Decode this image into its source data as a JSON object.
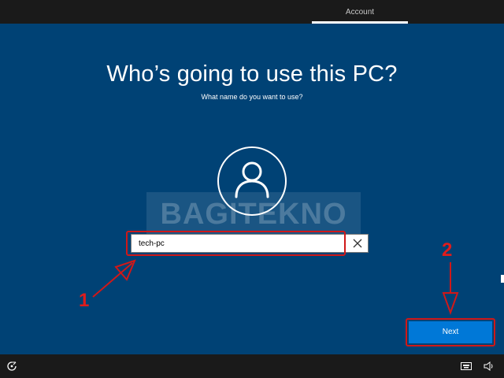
{
  "topbar": {
    "tab_account": "Account"
  },
  "page": {
    "headline": "Who’s going to use this PC?",
    "subtitle": "What name do you want to use?"
  },
  "watermark": "BAGITEKNO",
  "name_field": {
    "value": "tech-pc"
  },
  "annotations": {
    "step1": "1",
    "step2": "2"
  },
  "next_button": {
    "label": "Next"
  },
  "icons": {
    "avatar": "user-icon",
    "clear": "close-icon",
    "ease_of_access": "ease-of-access-icon",
    "keyboard": "keyboard-icon",
    "volume": "volume-icon"
  },
  "colors": {
    "background": "#004275",
    "accent": "#0078d7",
    "annotation": "#d01818",
    "bar": "#1a1a1a"
  }
}
